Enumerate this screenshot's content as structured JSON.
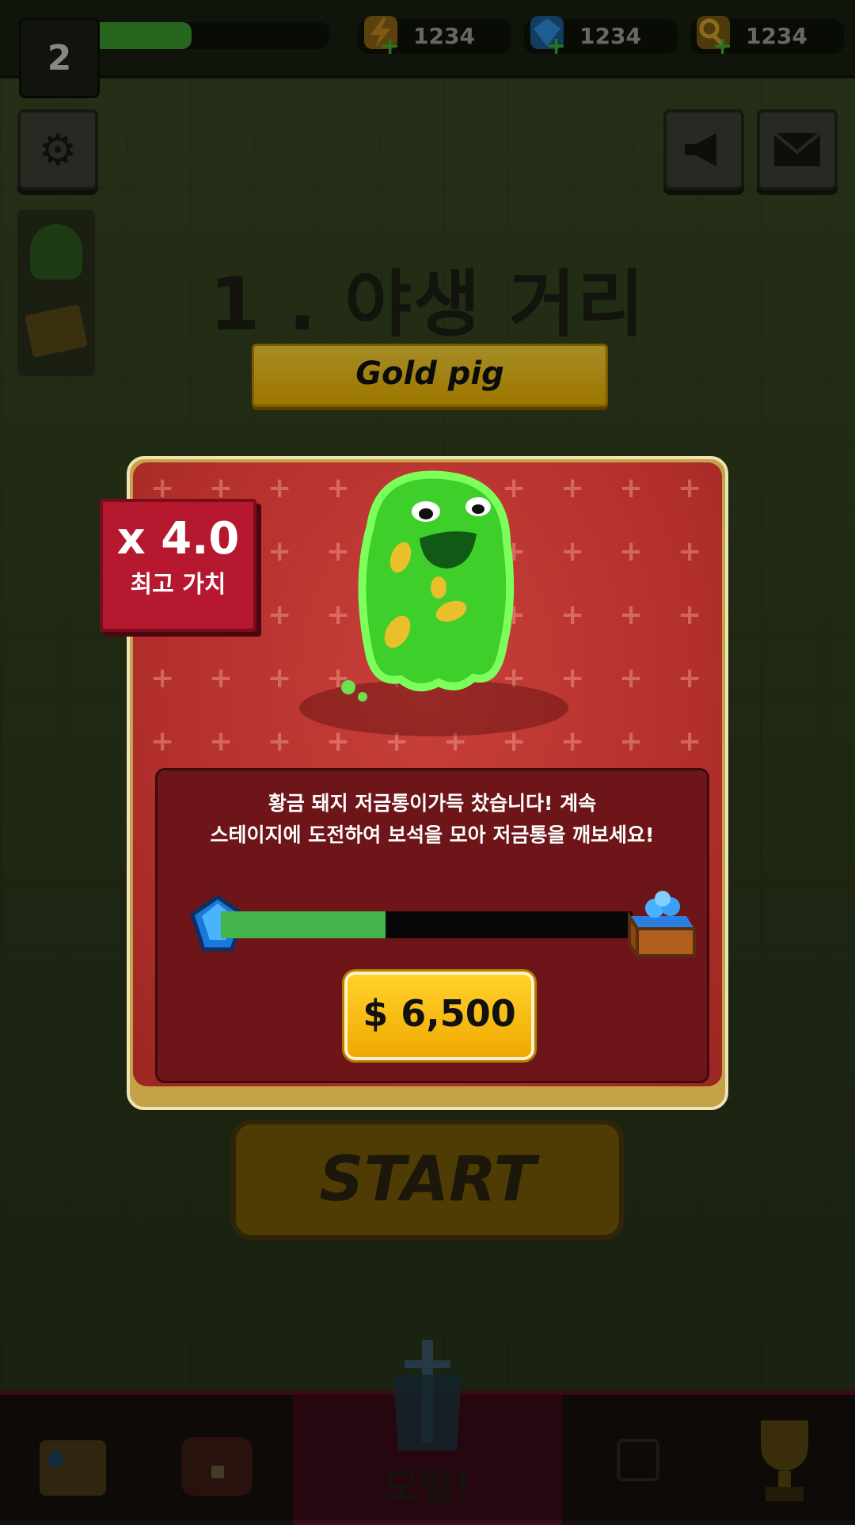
{
  "top_bar": {
    "level": "2",
    "xp_progress": 0.45,
    "resources": [
      {
        "name": "energy",
        "icon": "lightning-icon",
        "value": "1234",
        "color": "#d9a21f"
      },
      {
        "name": "gems",
        "icon": "gem-icon",
        "value": "1234",
        "color": "#2f8fe0"
      },
      {
        "name": "keys",
        "icon": "key-icon",
        "value": "1234",
        "color": "#d7a52a"
      }
    ]
  },
  "stage": {
    "title": "1 . 야생 거리",
    "banner": "Gold pig"
  },
  "popup": {
    "multiplier": "x 4.0",
    "multiplier_label": "최고 가치",
    "message_line1": "황금 돼지 저금통이가득 찼습니다! 계속",
    "message_line2": "스테이지에 도전하여 보석을 모아 저금통을 깨보세요!",
    "progress": 0.4,
    "price": "$ 6,500"
  },
  "start_button": "START",
  "nav": {
    "active_label": "모험!",
    "items": [
      "shop-icon",
      "chest-icon",
      "adventure-icon",
      "locked-icon",
      "trophy-icon"
    ]
  },
  "colors": {
    "accent_gold": "#f2b600",
    "popup_red": "#b22f2c",
    "progress_green": "#43b54a",
    "badge_red": "#b5182f"
  }
}
